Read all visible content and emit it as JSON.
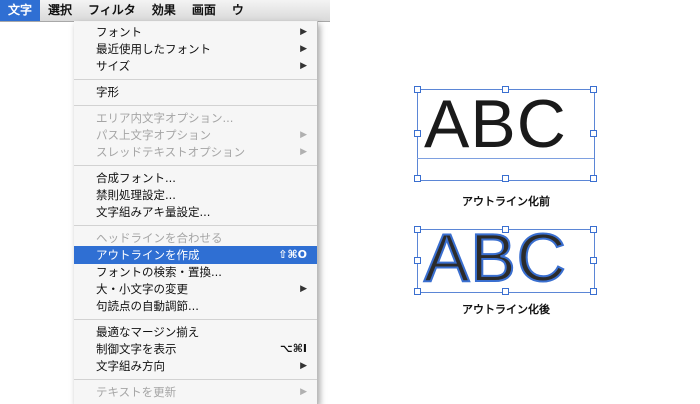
{
  "menubar": {
    "items": [
      {
        "label": "文字",
        "active": true
      },
      {
        "label": "選択"
      },
      {
        "label": "フィルタ"
      },
      {
        "label": "効果"
      },
      {
        "label": "画面"
      },
      {
        "label": "ウ"
      }
    ]
  },
  "menu": {
    "items": [
      {
        "label": "フォント",
        "submenu": true
      },
      {
        "label": "最近使用したフォント",
        "submenu": true
      },
      {
        "label": "サイズ",
        "submenu": true
      },
      {
        "label": "字形"
      },
      {
        "label": "エリア内文字オプション...",
        "disabled": true
      },
      {
        "label": "パス上文字オプション",
        "disabled": true,
        "submenu": true
      },
      {
        "label": "スレッドテキストオプション",
        "disabled": true,
        "submenu": true
      },
      {
        "label": "合成フォント..."
      },
      {
        "label": "禁則処理設定..."
      },
      {
        "label": "文字組みアキ量設定..."
      },
      {
        "label": "ヘッドラインを合わせる",
        "disabled": true
      },
      {
        "label": "アウトラインを作成",
        "selected": true,
        "shortcut": "⇧⌘O"
      },
      {
        "label": "フォントの検索・置換..."
      },
      {
        "label": "大・小文字の変更",
        "submenu": true
      },
      {
        "label": "句読点の自動調節..."
      },
      {
        "label": "最適なマージン揃え"
      },
      {
        "label": "制御文字を表示",
        "shortcut": "⌥⌘I"
      },
      {
        "label": "文字組み方向",
        "submenu": true
      },
      {
        "label": "テキストを更新",
        "disabled": true,
        "submenu": true
      }
    ]
  },
  "samples": {
    "before": {
      "text": "ABC",
      "caption": "アウトライン化前"
    },
    "after": {
      "text": "ABC",
      "caption": "アウトライン化後"
    }
  },
  "colors": {
    "selection": "#2f6fd3",
    "handle": "#3a6fd0"
  }
}
